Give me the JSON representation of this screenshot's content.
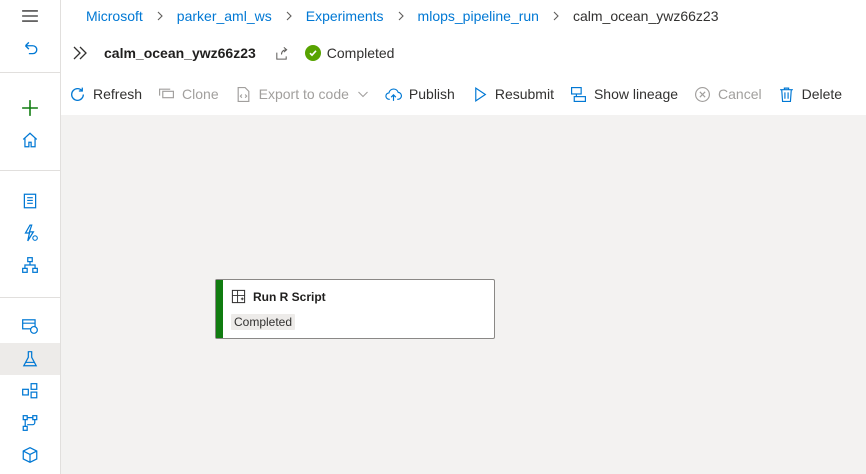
{
  "breadcrumb": {
    "items": [
      "Microsoft",
      "parker_aml_ws",
      "Experiments",
      "mlops_pipeline_run"
    ],
    "current": "calm_ocean_ywz66z23"
  },
  "header": {
    "run_name": "calm_ocean_ywz66z23",
    "status": "Completed",
    "status_color": "#57a300"
  },
  "toolbar": {
    "refresh": "Refresh",
    "clone": "Clone",
    "export": "Export to code",
    "publish": "Publish",
    "resubmit": "Resubmit",
    "lineage": "Show lineage",
    "cancel": "Cancel",
    "delete": "Delete"
  },
  "node": {
    "title": "Run R Script",
    "status": "Completed",
    "status_color": "#107c10"
  },
  "rail_icons": [
    "hamburger-icon",
    "back-icon",
    "plus-icon",
    "home-icon",
    "notebook-icon",
    "automl-icon",
    "designer-icon",
    "datasets-icon",
    "experiments-icon",
    "pipelines-icon",
    "models-icon",
    "endpoints-icon"
  ]
}
